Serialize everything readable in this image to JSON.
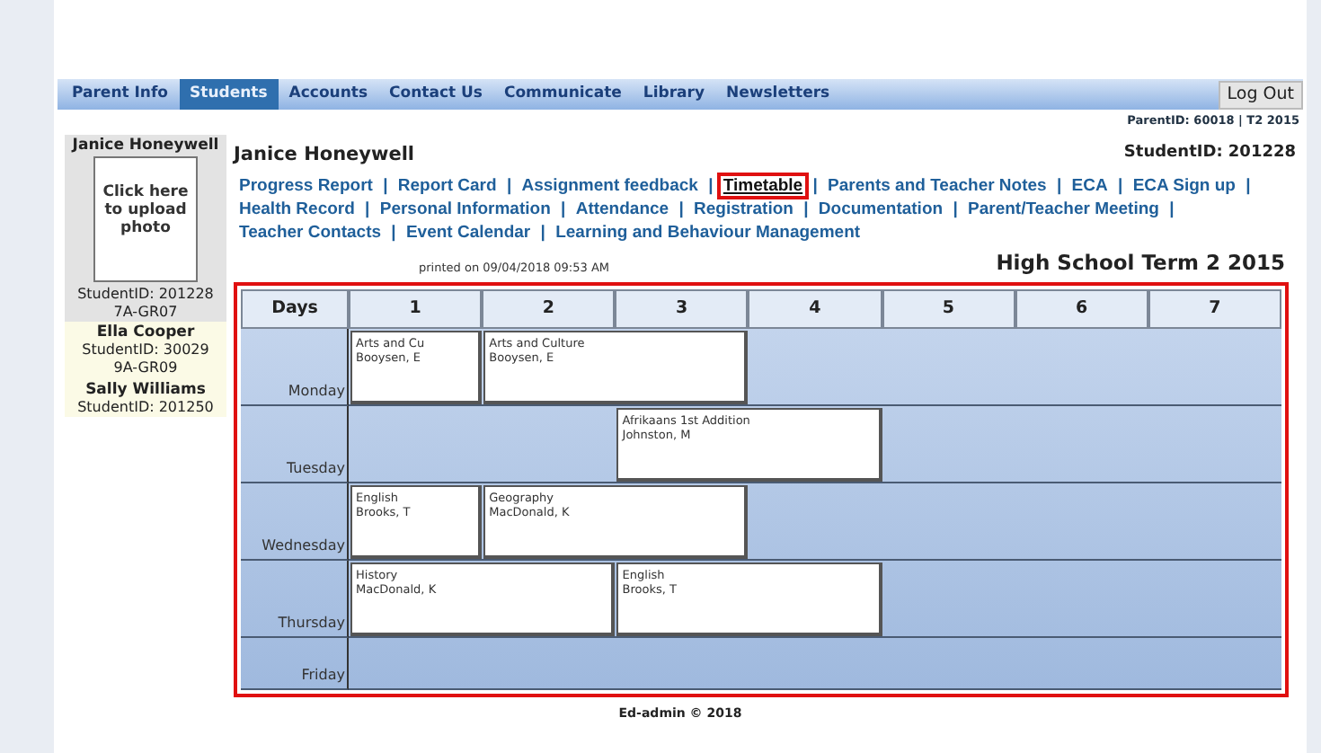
{
  "nav": {
    "tabs": [
      {
        "label": "Parent Info",
        "selected": false
      },
      {
        "label": "Students",
        "selected": true
      },
      {
        "label": "Accounts",
        "selected": false
      },
      {
        "label": "Contact Us",
        "selected": false
      },
      {
        "label": "Communicate",
        "selected": false
      },
      {
        "label": "Library",
        "selected": false
      },
      {
        "label": "Newsletters",
        "selected": false
      }
    ],
    "logout": "Log Out",
    "parent_info": "ParentID: 60018 | T2 2015"
  },
  "sidebar": {
    "students": [
      {
        "name": "Janice Honeywell",
        "selected": true,
        "photo": "Click here to upload photo",
        "student_id": "StudentID: 201228",
        "class": "7A-GR07"
      },
      {
        "name": "Ella Cooper",
        "selected": false,
        "student_id": "StudentID: 30029",
        "class": "9A-GR09"
      },
      {
        "name": "Sally Williams",
        "selected": false,
        "student_id": "StudentID: 201250"
      }
    ]
  },
  "main": {
    "student_name": "Janice Honeywell",
    "student_id": "StudentID: 201228",
    "separator": "|",
    "links": [
      {
        "label": "Progress Report",
        "selected": false,
        "highlighted": false
      },
      {
        "label": "Report Card",
        "selected": false,
        "highlighted": false
      },
      {
        "label": "Assignment feedback",
        "selected": false,
        "highlighted": false
      },
      {
        "label": "Timetable",
        "selected": true,
        "highlighted": true
      },
      {
        "label": "Parents and Teacher Notes",
        "selected": false,
        "highlighted": false
      },
      {
        "label": "ECA",
        "selected": false,
        "highlighted": false
      },
      {
        "label": "ECA Sign up",
        "selected": false,
        "highlighted": false
      },
      {
        "label": "Health Record",
        "selected": false,
        "highlighted": false
      },
      {
        "label": "Personal Information",
        "selected": false,
        "highlighted": false
      },
      {
        "label": "Attendance",
        "selected": false,
        "highlighted": false
      },
      {
        "label": "Registration",
        "selected": false,
        "highlighted": false
      },
      {
        "label": "Documentation",
        "selected": false,
        "highlighted": false
      },
      {
        "label": "Parent/Teacher Meeting",
        "selected": false,
        "highlighted": false
      },
      {
        "label": "Teacher Contacts",
        "selected": false,
        "highlighted": false
      },
      {
        "label": "Event Calendar",
        "selected": false,
        "highlighted": false
      },
      {
        "label": "Learning and Behaviour Management",
        "selected": false,
        "highlighted": false
      }
    ],
    "printed": "printed on 09/04/2018 09:53 AM",
    "term": "High School Term 2 2015"
  },
  "timetable": {
    "highlighted": true,
    "days_header": "Days",
    "periods": [
      "1",
      "2",
      "3",
      "4",
      "5",
      "6",
      "7"
    ],
    "days": [
      {
        "day": "Monday",
        "cells": [
          {
            "kind": "single",
            "subject": "Arts and Cu",
            "teacher": "Booysen, E"
          },
          {
            "kind": "double",
            "subject": "Arts and Culture",
            "teacher": "Booysen, E"
          }
        ]
      },
      {
        "day": "Tuesday",
        "cells": [
          {
            "kind": "gap"
          },
          {
            "kind": "double",
            "subject": "Afrikaans 1st Addition",
            "teacher": "Johnston, M"
          }
        ]
      },
      {
        "day": "Wednesday",
        "cells": [
          {
            "kind": "single",
            "subject": "English",
            "teacher": "Brooks, T"
          },
          {
            "kind": "double",
            "subject": "Geography",
            "teacher": "MacDonald, K"
          }
        ]
      },
      {
        "day": "Thursday",
        "cells": [
          {
            "kind": "double",
            "subject": "History",
            "teacher": "MacDonald, K"
          },
          {
            "kind": "double",
            "subject": "English",
            "teacher": "Brooks, T"
          }
        ]
      },
      {
        "day": "Friday"
      }
    ]
  },
  "footer": "Ed-admin © 2018"
}
